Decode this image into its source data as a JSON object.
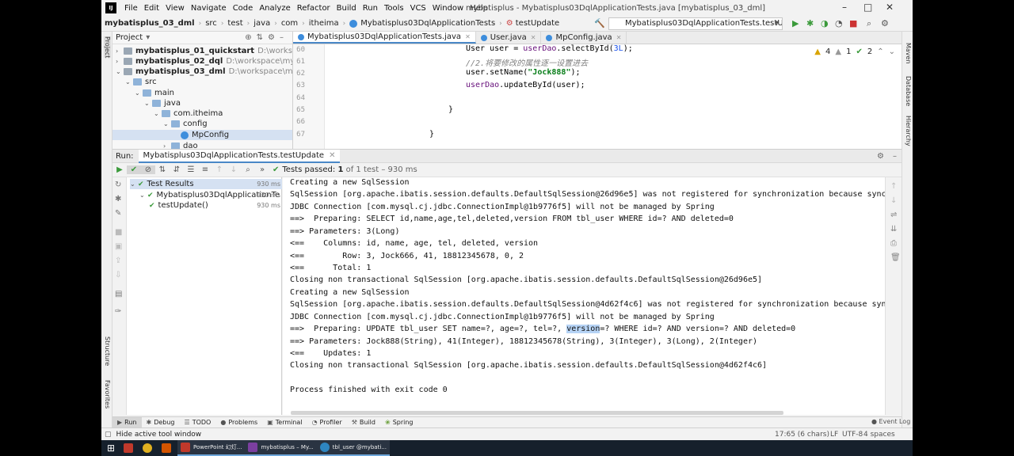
{
  "menu": {
    "items": [
      "File",
      "Edit",
      "View",
      "Navigate",
      "Code",
      "Analyze",
      "Refactor",
      "Build",
      "Run",
      "Tools",
      "VCS",
      "Window",
      "Help"
    ],
    "window_title": "mybatisplus - Mybatisplus03DqlApplicationTests.java [mybatisplus_03_dml]"
  },
  "nav": {
    "crumbs": [
      "mybatisplus_03_dml",
      "src",
      "test",
      "java",
      "com",
      "itheima",
      "Mybatisplus03DqlApplicationTests",
      "testUpdate"
    ],
    "run_config": "Mybatisplus03DqlApplicationTests.testUpdate"
  },
  "project": {
    "title": "Project",
    "rows": [
      {
        "name": "mybatisplus_01_quickstart",
        "path": "D:\\workspace\\mybati"
      },
      {
        "name": "mybatisplus_02_dql",
        "path": "D:\\workspace\\mybatisplu"
      },
      {
        "name": "mybatisplus_03_dml",
        "path": "D:\\workspace\\mybatisplu"
      },
      {
        "name": "src"
      },
      {
        "name": "main"
      },
      {
        "name": "java"
      },
      {
        "name": "com.itheima"
      },
      {
        "name": "config"
      },
      {
        "name": "MpConfig"
      },
      {
        "name": "dao"
      }
    ]
  },
  "editor": {
    "tabs": [
      "Mybatisplus03DqlApplicationTests.java",
      "User.java",
      "MpConfig.java"
    ],
    "line_numbers": [
      "60",
      "61",
      "62",
      "63",
      "64",
      "65",
      "66",
      "67"
    ],
    "line60": {
      "a": "User user = ",
      "b": "userDao",
      "c": ".selectById(",
      "d": "3L",
      "e": ");"
    },
    "line61": "//2.将要修改的属性逐一设置进去",
    "line62": {
      "a": "user.setName(",
      "b": "\"Jock888\"",
      "c": ");"
    },
    "line63": {
      "a": "userDao",
      "b": ".updateById(user);"
    },
    "line65": "}",
    "line67": "}",
    "warnings": {
      "warn": "4",
      "weak": "1",
      "typo": "2"
    }
  },
  "run": {
    "label": "Run:",
    "tab": "Mybatisplus03DqlApplicationTests.testUpdate",
    "status_prefix": "Tests passed:",
    "status_count": "1",
    "status_suffix": "of 1 test – 930 ms"
  },
  "results": {
    "root": "Test Results",
    "root_time": "930 ms",
    "class": "Mybatisplus03DqlApplicationTe",
    "class_time": "930 ms",
    "method": "testUpdate()",
    "method_time": "930 ms"
  },
  "console": {
    "lines": [
      "Creating a new SqlSession",
      "SqlSession [org.apache.ibatis.session.defaults.DefaultSqlSession@26d96e5] was not registered for synchronization because synchro",
      "JDBC Connection [com.mysql.cj.jdbc.ConnectionImpl@1b9776f5] will not be managed by Spring",
      "==>  Preparing: SELECT id,name,age,tel,deleted,version FROM tbl_user WHERE id=? AND deleted=0",
      "==> Parameters: 3(Long)",
      "<==    Columns: id, name, age, tel, deleted, version",
      "<==        Row: 3, Jock666, 41, 18812345678, 0, 2",
      "<==      Total: 1",
      "Closing non transactional SqlSession [org.apache.ibatis.session.defaults.DefaultSqlSession@26d96e5]",
      "Creating a new SqlSession",
      "SqlSession [org.apache.ibatis.session.defaults.DefaultSqlSession@4d62f4c6] was not registered for synchronization because synchr",
      "JDBC Connection [com.mysql.cj.jdbc.ConnectionImpl@1b9776f5] will not be managed by Spring",
      "",
      "==> Parameters: Jock888(String), 41(Integer), 18812345678(String), 3(Integer), 3(Long), 2(Integer)",
      "<==    Updates: 1",
      "Closing non transactional SqlSession [org.apache.ibatis.session.defaults.DefaultSqlSession@4d62f4c6]",
      "",
      "Process finished with exit code 0"
    ],
    "update_pre": "==>  Preparing: UPDATE tbl_user SET name=?, age=?, tel=?, ",
    "update_hl": "version",
    "update_post": "=? WHERE id=? AND version=? AND deleted=0"
  },
  "bottom_tabs": [
    "Run",
    "Debug",
    "TODO",
    "Problems",
    "Terminal",
    "Profiler",
    "Build",
    "Spring"
  ],
  "side_left": [
    "Project",
    "Structure",
    "Favorites"
  ],
  "side_right": [
    "Maven",
    "Database",
    "Hierarchy"
  ],
  "status": {
    "hint": "Hide active tool window",
    "pos": "17:65 (6 chars)",
    "lf": "LF",
    "enc": "UTF-8",
    "indent": "4 spaces",
    "event": "Event Log"
  },
  "taskbar": {
    "items": [
      "PowerPoint 幻灯...",
      "mybatisplus – My...",
      "tbl_user @mybati..."
    ]
  }
}
